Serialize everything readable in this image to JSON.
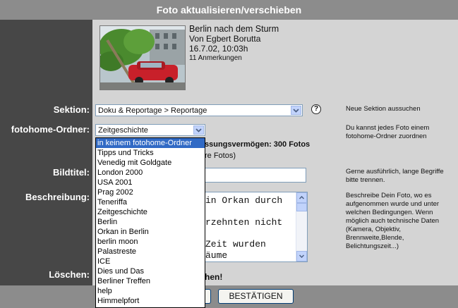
{
  "window_title": "Foto aktualisieren/verschieben",
  "photo": {
    "title": "Berlin nach dem Sturm",
    "author": "Von Egbert Borutta",
    "datetime": "16.7.02, 10:03h",
    "comments": "11 Anmerkungen"
  },
  "labels": {
    "sektion": "Sektion:",
    "ordner": "fotohome-Ordner:",
    "bildtitel": "Bildtitel:",
    "beschreibung": "Beschreibung:",
    "loeschen": "Löschen:"
  },
  "sektion_select": {
    "value": "Doku & Reportage > Reportage"
  },
  "ordner_select": {
    "value": "Zeitgeschichte",
    "options": [
      "in keinem fotohome-Ordner",
      "Tipps und Tricks",
      "Venedig mit Goldgate",
      "London 2000",
      "USA 2001",
      "Prag 2002",
      "Teneriffa",
      "Zeitgeschichte",
      "Berlin",
      "Orkan in Berlin",
      "berlin moon",
      "Palastreste",
      "ICE",
      "Dies und Das",
      "Berliner Treffen",
      "help",
      "Himmelpfort"
    ],
    "highlighted_index": 0
  },
  "storage_text": "ssungsvermögen: 300 Fotos",
  "storage_sub": "re Fotos)",
  "description_lines": [
    "in Orkan durch",
    "rzehnten nicht",
    " Zeit wurden",
    "äume"
  ],
  "loeschen_text": "hen!",
  "hints": {
    "sektion": "Neue Sektion aussuchen",
    "ordner": "Du kannst jedes Foto einem fotohome-Ordner zuordnen",
    "bildtitel": "Gerne ausführlich, lange Begriffe bitte trennen.",
    "beschreibung": "Beschreibe Dein Foto, wo es aufgenommen wurde und unter welchen Bedingungen. Wenn möglich auch technische Daten (Kamera, Objektiv, Brennweite,Blende, Belichtungszeit...)"
  },
  "buttons": {
    "confirm": "BESTÄTIGEN"
  },
  "help_icon_glyph": "?"
}
